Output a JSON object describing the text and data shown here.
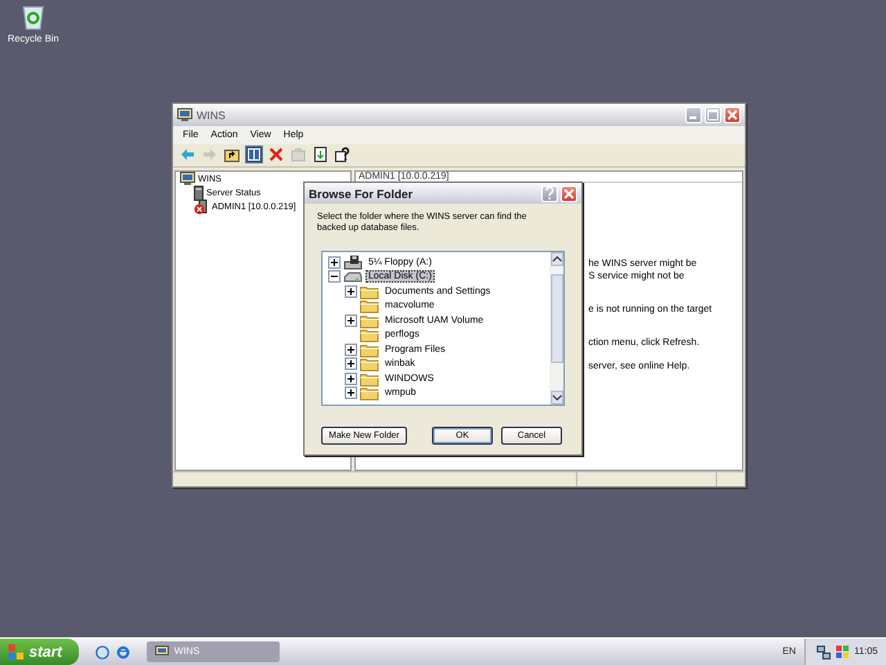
{
  "desktop": {
    "icons": [
      {
        "label": "Recycle Bin"
      }
    ]
  },
  "window": {
    "title": "WINS",
    "menu": [
      "File",
      "Action",
      "View",
      "Help"
    ],
    "toolbar": [
      {
        "kind": "back",
        "disabled": false,
        "pressed": false
      },
      {
        "kind": "forward",
        "disabled": true,
        "pressed": false
      },
      {
        "kind": "up",
        "disabled": false,
        "pressed": false
      },
      {
        "kind": "tree",
        "disabled": false,
        "pressed": true
      },
      {
        "kind": "delete",
        "disabled": false,
        "pressed": false
      },
      {
        "kind": "properties",
        "disabled": true,
        "pressed": false
      },
      {
        "kind": "export",
        "disabled": false,
        "pressed": false
      },
      {
        "kind": "help",
        "disabled": false,
        "pressed": false
      }
    ],
    "tree": [
      {
        "label": "WINS",
        "kind": "server",
        "children": [
          {
            "label": "Server Status",
            "kind": "status"
          },
          {
            "label": "ADMIN1 [10.0.0.219]",
            "kind": "error"
          }
        ]
      }
    ],
    "pane_header": "ADMIN1 [10.0.0.219]",
    "pane_lines": [
      "he WINS server might be",
      "S service might not be",
      "e is not running on the target",
      "ction menu, click Refresh.",
      "server, see online Help."
    ]
  },
  "dialog": {
    "title": "Browse For Folder",
    "description": "Select the folder where the WINS server can find the backed up database files.",
    "tree": [
      {
        "label": "5¼ Floppy (A:)",
        "kind": "floppy",
        "expanded": false,
        "selected": false
      },
      {
        "label": "Local Disk (C:)",
        "kind": "disk",
        "expanded": true,
        "selected": true,
        "children": [
          {
            "label": "Documents and Settings",
            "kind": "folder",
            "expanded": false,
            "selected": false
          },
          {
            "label": "macvolume",
            "kind": "folder",
            "selected": false
          },
          {
            "label": "Microsoft UAM Volume",
            "kind": "folder",
            "expanded": false,
            "selected": false
          },
          {
            "label": "perflogs",
            "kind": "folder",
            "selected": false
          },
          {
            "label": "Program Files",
            "kind": "folder",
            "expanded": false,
            "selected": false
          },
          {
            "label": "winbak",
            "kind": "folder",
            "expanded": false,
            "selected": false
          },
          {
            "label": "WINDOWS",
            "kind": "folder",
            "expanded": false,
            "selected": false
          },
          {
            "label": "wmpub",
            "kind": "folder",
            "expanded": false,
            "selected": false
          }
        ]
      }
    ],
    "buttons": [
      {
        "label": "Make New Folder",
        "default": false
      },
      {
        "label": "OK",
        "default": true
      },
      {
        "label": "Cancel",
        "default": false
      }
    ]
  },
  "taskbar": {
    "start": "start",
    "tasks": [
      {
        "label": "WINS",
        "selected": false
      }
    ],
    "language": "EN",
    "clock": "11:05"
  }
}
